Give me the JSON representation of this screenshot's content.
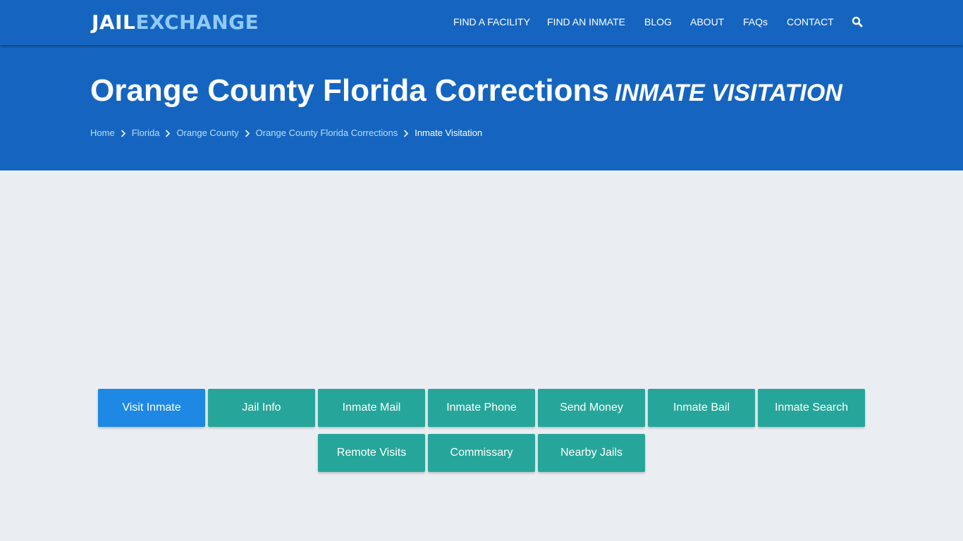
{
  "brand": {
    "part1": "JAIL",
    "part2": "EXCHANGE"
  },
  "nav": {
    "items": [
      {
        "label": "FIND A FACILITY"
      },
      {
        "label": "FIND AN INMATE"
      },
      {
        "label": "BLOG"
      },
      {
        "label": "ABOUT"
      },
      {
        "label": "FAQs"
      },
      {
        "label": "CONTACT"
      }
    ],
    "search_icon": "search-icon"
  },
  "hero": {
    "title": "Orange County Florida Corrections",
    "subtitle": "INMATE VISITATION"
  },
  "breadcrumb": [
    {
      "label": "Home"
    },
    {
      "label": "Florida"
    },
    {
      "label": "Orange County"
    },
    {
      "label": "Orange County Florida Corrections"
    },
    {
      "label": "Inmate Visitation"
    }
  ],
  "buttons": [
    {
      "label": "Visit Inmate",
      "active": true
    },
    {
      "label": "Jail Info"
    },
    {
      "label": "Inmate Mail"
    },
    {
      "label": "Inmate Phone"
    },
    {
      "label": "Send Money"
    },
    {
      "label": "Inmate Bail"
    },
    {
      "label": "Inmate Search"
    },
    {
      "label": "Remote Visits"
    },
    {
      "label": "Commissary"
    },
    {
      "label": "Nearby Jails"
    }
  ],
  "colors": {
    "primary": "#1565c0",
    "accent_light": "#90caf9",
    "button_teal": "#26a69a",
    "button_active": "#1e88e5",
    "background": "#eaeef2"
  }
}
